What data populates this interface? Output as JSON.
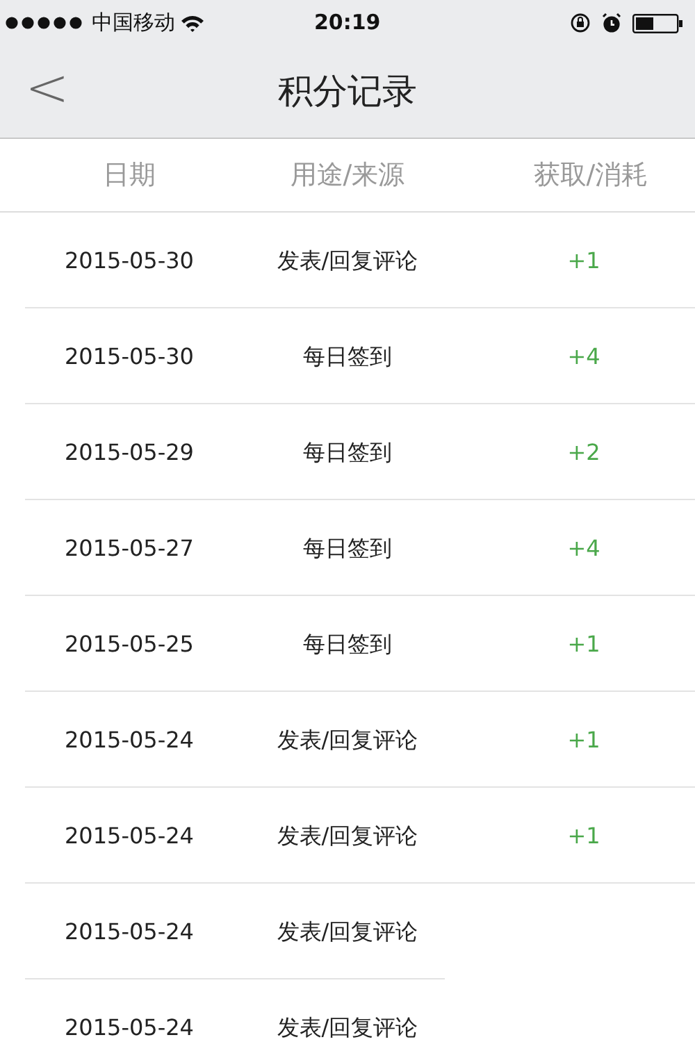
{
  "status_bar": {
    "carrier": "中国移动",
    "time": "20:19"
  },
  "nav": {
    "back": "<",
    "title": "积分记录"
  },
  "table": {
    "columns": [
      "日期",
      "用途/来源",
      "获取/消耗"
    ],
    "rows": [
      {
        "date": "2015-05-30",
        "source": "发表/回复评论",
        "points": "+1"
      },
      {
        "date": "2015-05-30",
        "source": "每日签到",
        "points": "+4"
      },
      {
        "date": "2015-05-29",
        "source": "每日签到",
        "points": "+2"
      },
      {
        "date": "2015-05-27",
        "source": "每日签到",
        "points": "+4"
      },
      {
        "date": "2015-05-25",
        "source": "每日签到",
        "points": "+1"
      },
      {
        "date": "2015-05-24",
        "source": "发表/回复评论",
        "points": "+1"
      },
      {
        "date": "2015-05-24",
        "source": "发表/回复评论",
        "points": "+1"
      },
      {
        "date": "2015-05-24",
        "source": "发表/回复评论"
      },
      {
        "date": "2015-05-24",
        "source": "发表/回复评论"
      }
    ]
  }
}
